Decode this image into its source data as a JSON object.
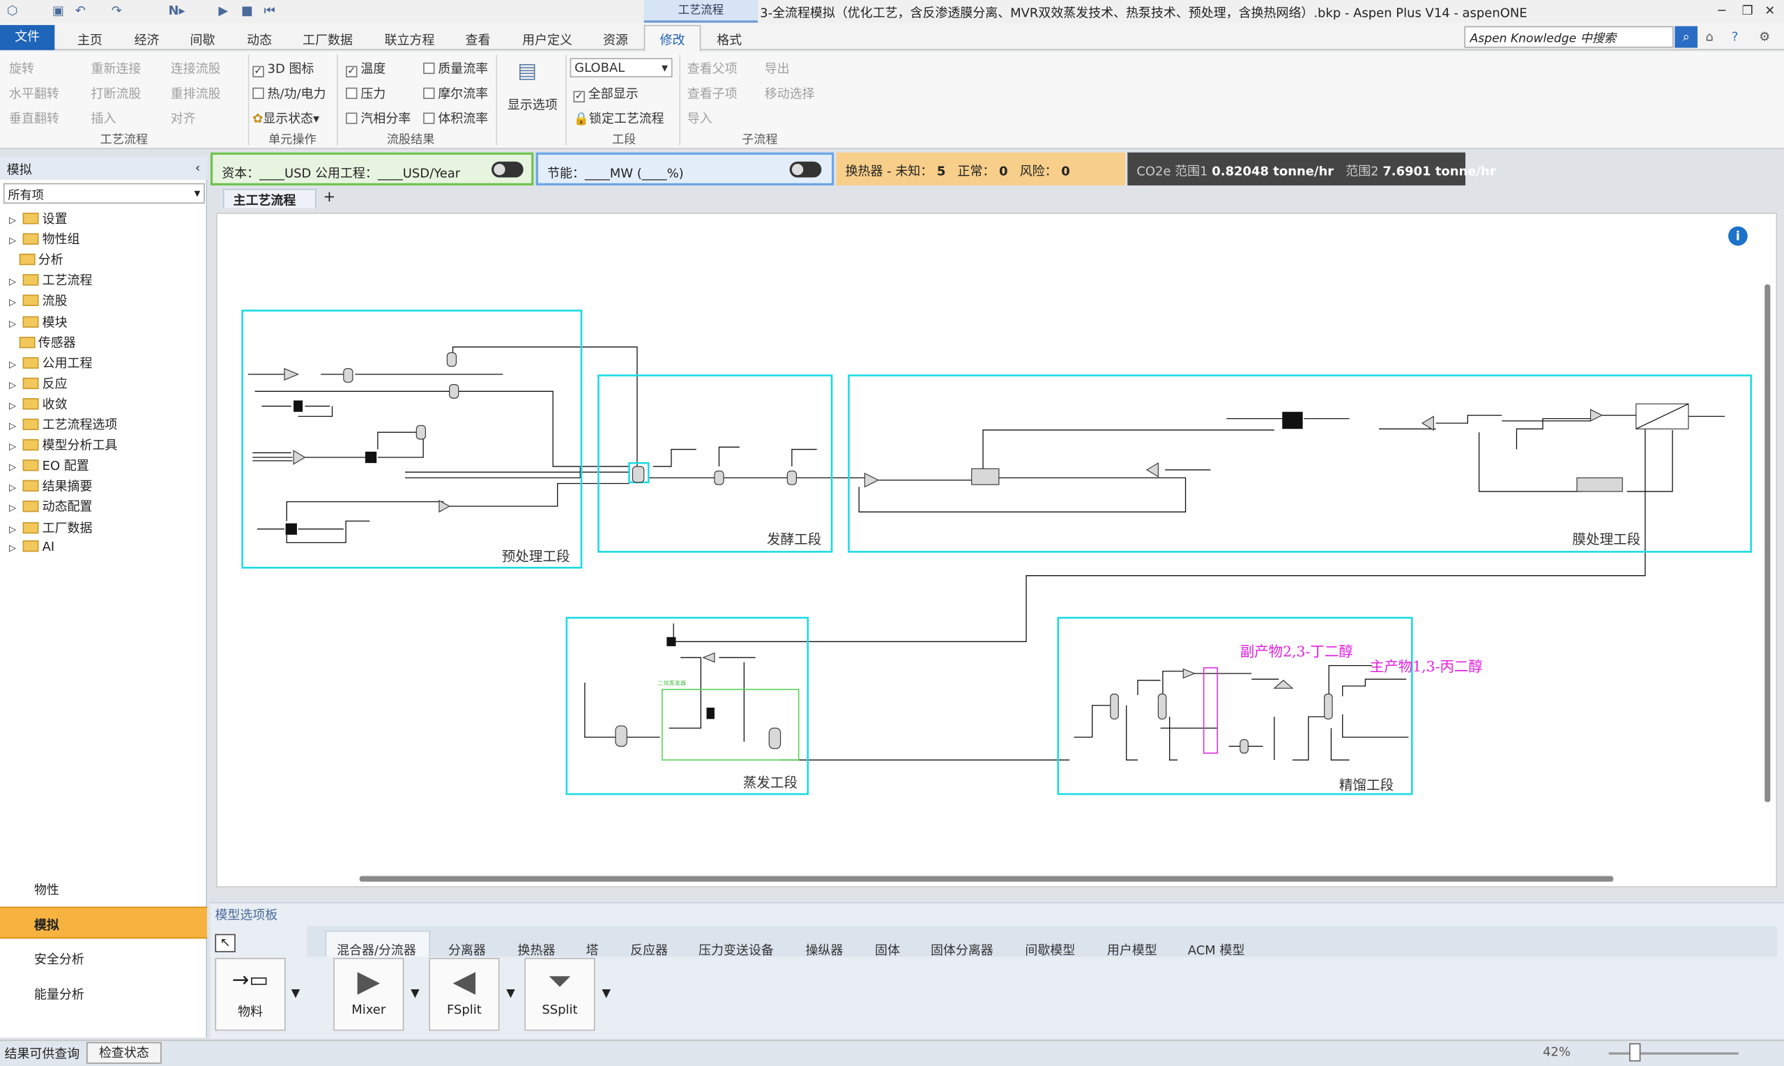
{
  "window": {
    "title": "3-全流程模拟（优化工艺，含反渗透膜分离、MVR双效蒸发技术、热泵技术、预处理，含换热网络）.bkp - Aspen Plus V14 - aspenONE",
    "context_header": "工艺流程"
  },
  "tabs": [
    "文件",
    "主页",
    "经济",
    "间歇",
    "动态",
    "工厂数据",
    "联立方程",
    "查看",
    "用户定义",
    "资源",
    "修改",
    "格式"
  ],
  "search_placeholder": "Aspen Knowledge 中搜索",
  "ribbon": {
    "flowsheet": {
      "rotate": "旋转",
      "hflip": "水平翻转",
      "vflip": "垂直翻转",
      "reconnect": "重新连接",
      "break": "打断流股",
      "insert": "插入",
      "connect": "连接流股",
      "reroute": "重排流股",
      "align": "对齐",
      "group": "工艺流程"
    },
    "unitops": {
      "icon3d": "3D 图标",
      "heat": "热/功/电力",
      "status": "显示状态",
      "group": "单元操作"
    },
    "stream": {
      "temp": "温度",
      "pressure": "压力",
      "vapor": "汽相分率",
      "mass": "质量流率",
      "mole": "摩尔流率",
      "vol": "体积流率",
      "group": "流股结果"
    },
    "display": {
      "label": "显示选项"
    },
    "section": {
      "combo": "GLOBAL",
      "showall": "全部显示",
      "lock": "锁定工艺流程",
      "group": "工段"
    },
    "sub": {
      "parent": "查看父项",
      "child": "查看子项",
      "import": "导入",
      "export": "导出",
      "move": "移动选择",
      "group": "子流程"
    }
  },
  "left_panel": {
    "title": "模拟",
    "filter": "所有项",
    "items": [
      "设置",
      "物性组",
      "分析",
      "工艺流程",
      "流股",
      "模块",
      "传感器",
      "公用工程",
      "反应",
      "收敛",
      "工艺流程选项",
      "模型分析工具",
      "EO 配置",
      "结果摘要",
      "动态配置",
      "工厂数据",
      "AI"
    ],
    "nav": [
      "物性",
      "模拟",
      "安全分析",
      "能量分析"
    ]
  },
  "strip": {
    "cost": "资本：____USD   公用工程：____USD/Year",
    "energy": "节能：____MW   (____%)",
    "hx_label": "换热器 - 未知：",
    "hx_unknown": "5",
    "hx_ok_label": "正常：",
    "hx_ok": "0",
    "hx_risk_label": "风险：",
    "hx_risk": "0",
    "co2_label1": "CO2e 范围1",
    "co2_v1": "0.82048 tonne/hr",
    "co2_label2": "范围2",
    "co2_v2": "7.6901 tonne/hr"
  },
  "flowsheet": {
    "tab": "主工艺流程",
    "sections": [
      "预处理工段",
      "发酵工段",
      "膜处理工段",
      "蒸发工段",
      "精馏工段"
    ],
    "byproduct": "副产物2,3-丁二醇",
    "product": "主产物1,3-丙二醇",
    "mvr_tag": "二效蒸发器"
  },
  "palette": {
    "title": "模型选项板",
    "tabs": [
      "混合器/分流器",
      "分离器",
      "换热器",
      "塔",
      "反应器",
      "压力变送设备",
      "操纵器",
      "固体",
      "固体分离器",
      "间歇模型",
      "用户模型",
      "ACM 模型"
    ],
    "models": [
      "物料",
      "Mixer",
      "FSplit",
      "SSplit"
    ]
  },
  "status": {
    "left": "结果可供查询",
    "check": "检查状态",
    "zoom": "42%"
  }
}
